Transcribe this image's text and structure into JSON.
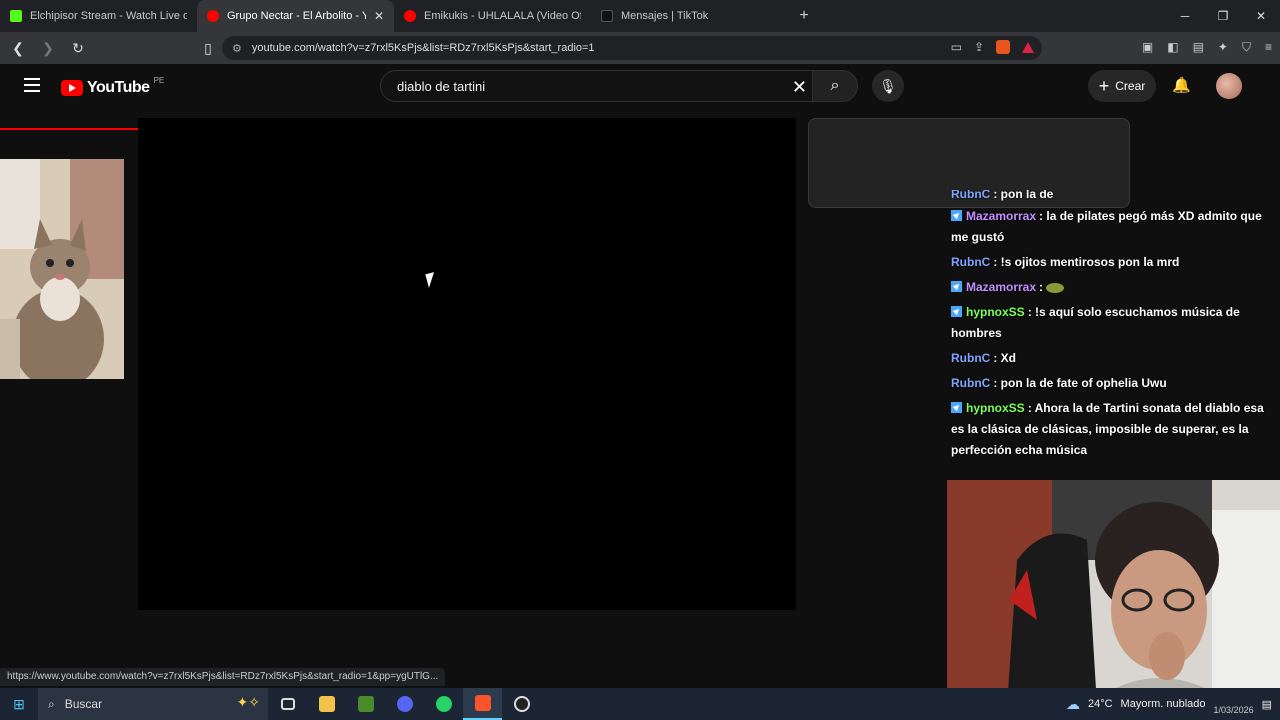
{
  "browser": {
    "tabs": [
      {
        "title": "Elchipisor Stream - Watch Live on",
        "favicon_color": "#53fc18",
        "active": false
      },
      {
        "title": "Grupo Nectar - El Arbolito - You",
        "favicon_color": "#ff0000",
        "active": true
      },
      {
        "title": "Emikukis - UHLALALA (Video Oficial)",
        "favicon_color": "#ff0000",
        "active": false
      },
      {
        "title": "Mensajes | TikTok",
        "favicon_color": "#111111",
        "active": false
      }
    ],
    "new_tab": "+",
    "url": "youtube.com/watch?v=z7rxl5KsPjs&list=RDz7rxl5KsPjs&start_radio=1",
    "status_url": "https://www.youtube.com/watch?v=z7rxl5KsPjs&list=RDz7rxl5KsPjs&start_radio=1&pp=ygUTlG..."
  },
  "youtube": {
    "logo_text": "YouTube",
    "region": "PE",
    "search_value": "diablo de tartini",
    "create_label": "Crear"
  },
  "chat": {
    "partial_top": {
      "user": "RubnC",
      "text": ": pon la de"
    },
    "messages": [
      {
        "user": "Mazamorrax",
        "color": "#c490ff",
        "badge": true,
        "text": ": la de pilates pegó más XD admito que me gustó"
      },
      {
        "user": "RubnC",
        "color": "#7fa4ff",
        "badge": false,
        "text": ": !s ojitos mentirosos pon la mrd"
      },
      {
        "user": "Mazamorrax",
        "color": "#c490ff",
        "badge": true,
        "text": ":",
        "emote": true
      },
      {
        "user": "hypnoxSS",
        "color": "#7cff5a",
        "badge": true,
        "text": ": !s aquí solo escuchamos música de hombres"
      },
      {
        "user": "RubnC",
        "color": "#7fa4ff",
        "badge": false,
        "text": ": Xd"
      },
      {
        "user": "RubnC",
        "color": "#7fa4ff",
        "badge": false,
        "text": ": pon la de fate of ophelia Uwu"
      },
      {
        "user": "hypnoxSS",
        "color": "#7cff5a",
        "badge": true,
        "text": ": Ahora la de Tartini sonata del diablo esa es la clásica de clásicas, imposible de superar, es la perfección echa música"
      }
    ]
  },
  "taskbar": {
    "search_label": "Buscar",
    "temperature": "24°C",
    "weather": "Mayorm. nublado",
    "date": "1/03/2026"
  }
}
